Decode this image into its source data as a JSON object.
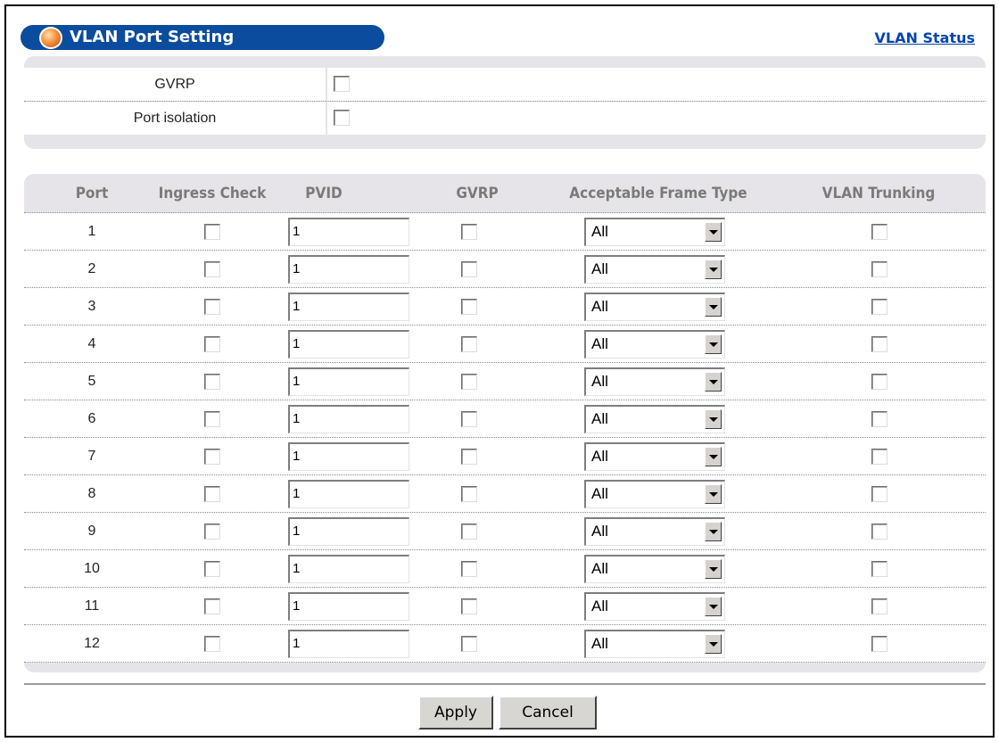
{
  "header": {
    "title": "VLAN Port Setting",
    "status_link": "VLAN Status"
  },
  "general": {
    "gvrp_label": "GVRP",
    "gvrp_checked": false,
    "port_isolation_label": "Port isolation",
    "port_isolation_checked": false
  },
  "table": {
    "columns": [
      "Port",
      "Ingress Check",
      "PVID",
      "GVRP",
      "Acceptable Frame Type",
      "VLAN Trunking"
    ],
    "rows": [
      {
        "port": "1",
        "ingress_check": false,
        "pvid": "1",
        "gvrp": false,
        "frame_type": "All",
        "vlan_trunking": false
      },
      {
        "port": "2",
        "ingress_check": false,
        "pvid": "1",
        "gvrp": false,
        "frame_type": "All",
        "vlan_trunking": false
      },
      {
        "port": "3",
        "ingress_check": false,
        "pvid": "1",
        "gvrp": false,
        "frame_type": "All",
        "vlan_trunking": false
      },
      {
        "port": "4",
        "ingress_check": false,
        "pvid": "1",
        "gvrp": false,
        "frame_type": "All",
        "vlan_trunking": false
      },
      {
        "port": "5",
        "ingress_check": false,
        "pvid": "1",
        "gvrp": false,
        "frame_type": "All",
        "vlan_trunking": false
      },
      {
        "port": "6",
        "ingress_check": false,
        "pvid": "1",
        "gvrp": false,
        "frame_type": "All",
        "vlan_trunking": false
      },
      {
        "port": "7",
        "ingress_check": false,
        "pvid": "1",
        "gvrp": false,
        "frame_type": "All",
        "vlan_trunking": false
      },
      {
        "port": "8",
        "ingress_check": false,
        "pvid": "1",
        "gvrp": false,
        "frame_type": "All",
        "vlan_trunking": false
      },
      {
        "port": "9",
        "ingress_check": false,
        "pvid": "1",
        "gvrp": false,
        "frame_type": "All",
        "vlan_trunking": false
      },
      {
        "port": "10",
        "ingress_check": false,
        "pvid": "1",
        "gvrp": false,
        "frame_type": "All",
        "vlan_trunking": false
      },
      {
        "port": "11",
        "ingress_check": false,
        "pvid": "1",
        "gvrp": false,
        "frame_type": "All",
        "vlan_trunking": false
      },
      {
        "port": "12",
        "ingress_check": false,
        "pvid": "1",
        "gvrp": false,
        "frame_type": "All",
        "vlan_trunking": false
      }
    ]
  },
  "buttons": {
    "apply": "Apply",
    "cancel": "Cancel"
  },
  "colors": {
    "title_bar": "#0b4c9e",
    "panel": "#e6e4e8",
    "link": "#0645ad",
    "header_text": "#7a7a7a"
  },
  "icons": {
    "title_orb": "orange-orb-icon",
    "select_arrow": "chevron-down-icon"
  }
}
